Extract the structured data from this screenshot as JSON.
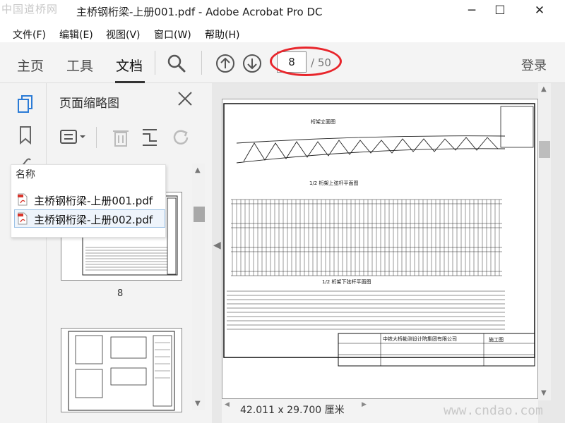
{
  "watermark": {
    "top": "中国道桥网",
    "bottom": "www.cndao.com"
  },
  "window": {
    "title": "主桥钢桁梁-上册001.pdf - Adobe Acrobat Pro DC",
    "minimize": "─",
    "maximize": "☐",
    "close": "✕"
  },
  "menu": {
    "items": [
      "文件(F)",
      "编辑(E)",
      "视图(V)",
      "窗口(W)",
      "帮助(H)"
    ]
  },
  "toolbar": {
    "tabs": [
      "主页",
      "工具",
      "文档"
    ],
    "active_tab": "文档",
    "page_current": "8",
    "page_total": "/ 50",
    "login": "登录"
  },
  "thumbnails_panel": {
    "title": "页面缩略图",
    "page_label": "8"
  },
  "file_popup": {
    "header": "名称",
    "files": [
      {
        "name": "主桥钢桁梁-上册001.pdf",
        "selected": false
      },
      {
        "name": "主桥钢桁梁-上册002.pdf",
        "selected": true
      }
    ]
  },
  "document": {
    "dimensions": "42.011 x 29.700 厘米",
    "drawing_titles": [
      "桁架立面图",
      "1/2 桁架上弦杆平面图",
      "1/2 桁架下弦杆平面图"
    ],
    "titleblock_company": "中铁大桥勘测设计院集团有限公司",
    "titleblock_stage": "施工图"
  },
  "colors": {
    "highlight_ellipse": "#e8252b",
    "selected_row": "#eef4fb"
  }
}
